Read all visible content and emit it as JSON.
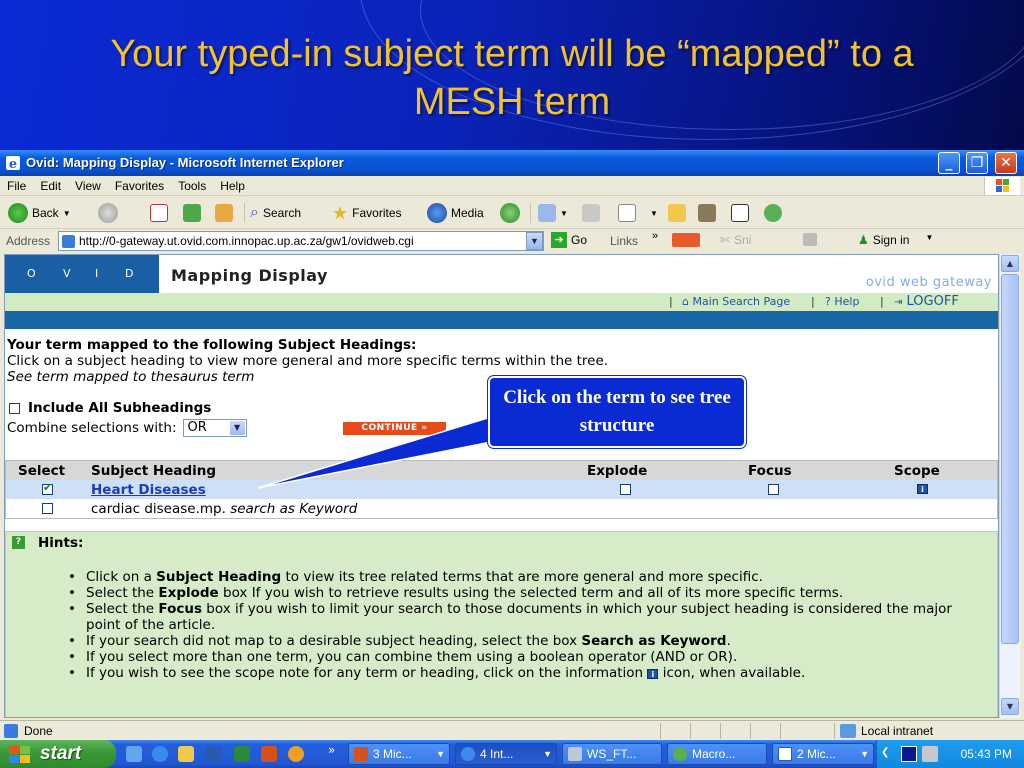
{
  "slide": {
    "title_line1": "Your typed-in subject term will be “mapped” to a",
    "title_line2": "MESH term",
    "callout": "Click on the term to see tree structure"
  },
  "window": {
    "title": "Ovid: Mapping Display - Microsoft Internet Explorer",
    "controls": [
      "_",
      "❐",
      "✕"
    ]
  },
  "menu": [
    "File",
    "Edit",
    "View",
    "Favorites",
    "Tools",
    "Help"
  ],
  "toolbar": {
    "back": "Back",
    "search": "Search",
    "favorites": "Favorites",
    "media": "Media"
  },
  "address": {
    "label": "Address",
    "url": "http://0-gateway.ut.ovid.com.innopac.up.ac.za/gw1/ovidweb.cgi",
    "go": "Go",
    "links": "Links",
    "snip": "Sni",
    "signin": "Sign in"
  },
  "page": {
    "logo_letters": [
      "O",
      "V",
      "I",
      "D"
    ],
    "title": "Mapping Display",
    "gateway": "ovid web gateway",
    "nav": {
      "main": "Main Search Page",
      "help": "Help",
      "logoff": "LOGOFF"
    },
    "intro": {
      "heading": "Your term mapped to the following Subject Headings:",
      "line2": "Click on a subject heading to view more general and more specific terms within the tree.",
      "line3": "See term mapped to thesaurus term"
    },
    "include_all": "Include All Subheadings",
    "combine_label": "Combine selections with:",
    "combine_value": "OR",
    "continue": "CONTINUE »",
    "table": {
      "headers": [
        "Select",
        "Subject Heading",
        "Explode",
        "Focus",
        "Scope"
      ],
      "rows": [
        {
          "heading": "Heart Diseases",
          "selected": true
        },
        {
          "heading": "cardiac disease.mp.",
          "suffix": "search as Keyword",
          "selected": false
        }
      ]
    },
    "hints": {
      "title": "Hints",
      "items": [
        [
          "Click on a ",
          "Subject Heading",
          " to view its tree    related terms that are more general and more specific."
        ],
        [
          "Select the ",
          "Explode",
          " box If you wish to retrieve results using the selected term and all of its more specific terms."
        ],
        [
          "Select the ",
          "Focus",
          " box if you wish to limit your search to those documents in which your subject heading is considered the major point of the article."
        ],
        [
          "If your search did not map to a desirable subject heading, select the box ",
          "Search as Keyword",
          "."
        ],
        [
          "If you select more than one term, you can combine them using a boolean operator (AND or OR).",
          "",
          ""
        ],
        [
          "If you wish to see the scope note for any term or heading, click on the information ",
          "",
          " icon, when available."
        ]
      ]
    }
  },
  "status": {
    "left": "Done",
    "zone": "Local intranet"
  },
  "taskbar": {
    "start": "start",
    "tasks": [
      "3 Mic...",
      "4 Int...",
      "WS_FT...",
      "Macro...",
      "2 Mic..."
    ],
    "clock": "05:43 PM"
  },
  "colors": {
    "title_gold": "#f2c12e",
    "ovid_blue": "#1a5fa4",
    "nav_green": "#d3ebc3",
    "continue_orange": "#e84a1a",
    "callout_blue": "#0a2ad4"
  }
}
